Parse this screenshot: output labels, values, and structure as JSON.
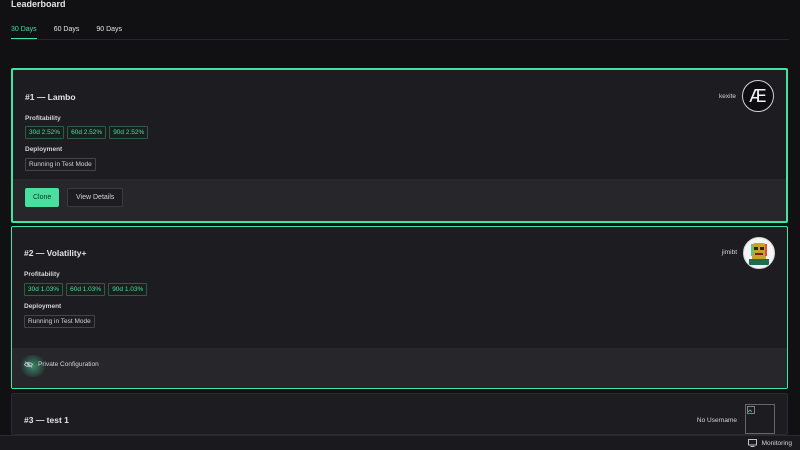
{
  "page_title": "Leaderboard",
  "tabs": [
    {
      "label": "30 Days",
      "active": true
    },
    {
      "label": "60 Days",
      "active": false
    },
    {
      "label": "90 Days",
      "active": false
    }
  ],
  "cards": [
    {
      "name": "#1 — Lambo",
      "owner": "kexite",
      "avatar_text": "Æ",
      "profitability_label": "Profitability",
      "profitability": [
        "30d 2.52%",
        "60d 2.52%",
        "90d 2.52%"
      ],
      "deployment_label": "Deployment",
      "deployment": "Running in Test Mode",
      "clone_label": "Clone",
      "view_label": "View Details"
    },
    {
      "name": "#2 — Volatility+",
      "owner": "jimibt",
      "profitability_label": "Profitability",
      "profitability": [
        "30d 1.03%",
        "60d 1.03%",
        "90d 1.03%"
      ],
      "deployment_label": "Deployment",
      "deployment": "Running in Test Mode",
      "private_label": "Private Configuration"
    },
    {
      "name": "#3 — test 1",
      "owner": "No Username"
    }
  ],
  "statusbar": {
    "monitoring_label": "Monitoring"
  },
  "colors": {
    "accent": "#4ade9f",
    "background": "#111114",
    "card": "#1c1c21"
  }
}
